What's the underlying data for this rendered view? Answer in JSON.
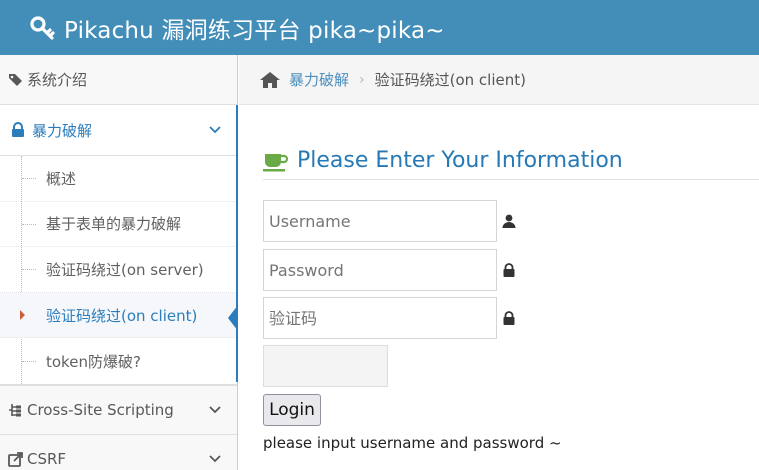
{
  "header": {
    "title": "Pikachu 漏洞练习平台 pika~pika~",
    "icon": "key-icon",
    "bg_color": "#438eb9"
  },
  "sidebar": {
    "items": [
      {
        "label": "系统介绍",
        "icon": "tags-icon",
        "expanded": false
      },
      {
        "label": "暴力破解",
        "icon": "lock-icon",
        "expanded": true
      },
      {
        "label": "Cross-Site Scripting",
        "icon": "hierarchy-icon",
        "expanded": false
      },
      {
        "label": "CSRF",
        "icon": "share-icon",
        "expanded": false
      }
    ],
    "submenu": [
      {
        "label": "概述"
      },
      {
        "label": "基于表单的暴力破解"
      },
      {
        "label": "验证码绕过(on server)"
      },
      {
        "label": "验证码绕过(on client)",
        "current": true
      },
      {
        "label": "token防爆破?"
      }
    ],
    "accent_color": "#2b7dbc"
  },
  "breadcrumb": {
    "parent": "暴力破解",
    "current": "验证码绕过(on client)",
    "icon": "home-icon"
  },
  "form": {
    "heading": "Please Enter Your Information",
    "heading_icon": "coffee-icon",
    "username_placeholder": "Username",
    "password_placeholder": "Password",
    "captcha_placeholder": "验证码",
    "login_label": "Login",
    "message": "please input username and password ~"
  }
}
